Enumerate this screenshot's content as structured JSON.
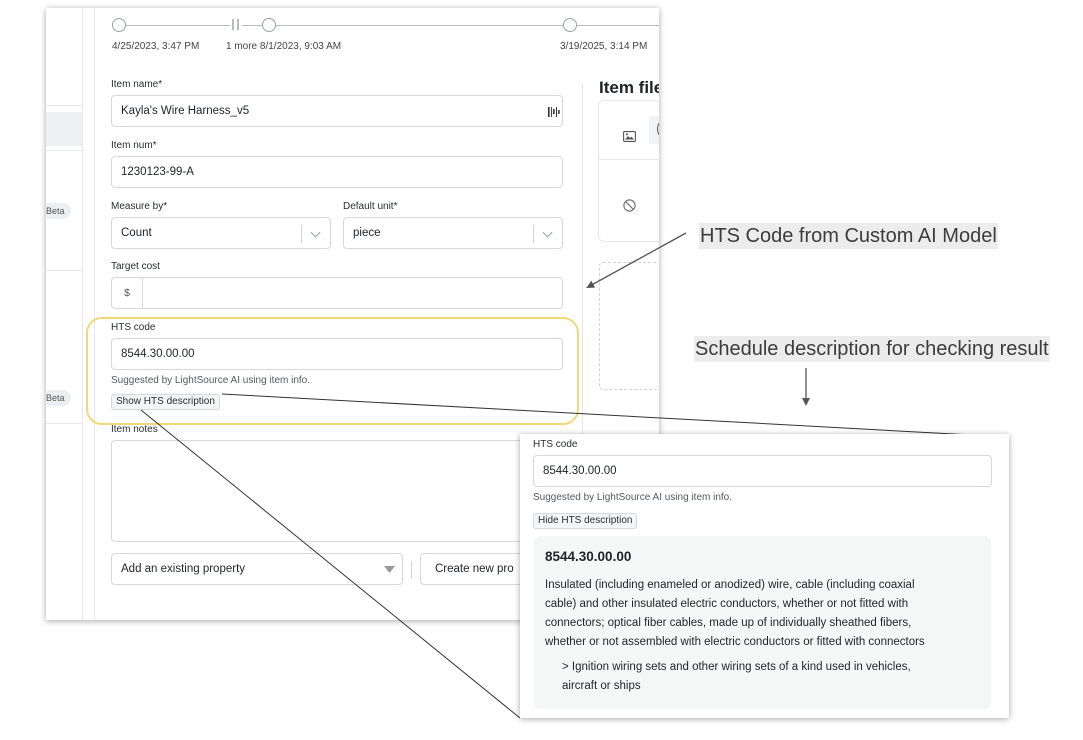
{
  "timeline": {
    "dates": [
      "4/25/2023, 3:47 PM",
      "1 more 8/1/2023, 9:03 AM",
      "3/19/2025, 3:14 PM"
    ]
  },
  "sidebar": {
    "badges": [
      "Beta",
      "Beta"
    ]
  },
  "form": {
    "item_name_label": "Item name*",
    "item_name_value": "Kayla's Wire Harness_v5",
    "item_num_label": "Item num*",
    "item_num_value": "1230123-99-A",
    "measure_label": "Measure by*",
    "measure_value": "Count",
    "unit_label": "Default unit*",
    "unit_value": "piece",
    "target_cost_label": "Target cost",
    "currency_symbol": "$",
    "target_cost_value": "",
    "hts_label": "HTS code",
    "hts_value": "8544.30.00.00",
    "hts_hint": "Suggested by LightSource AI using item info.",
    "show_hts_button": "Show HTS description",
    "notes_label": "Item notes",
    "add_property_label": "Add an existing property",
    "create_property_label": "Create new pro"
  },
  "right_panel": {
    "title": "Item file"
  },
  "annotations": {
    "hts_model": "HTS Code from Custom AI Model",
    "schedule_desc": "Schedule description for checking result"
  },
  "inset": {
    "hts_label": "HTS code",
    "hts_value": "8544.30.00.00",
    "hint": "Suggested by LightSource AI using item info.",
    "hide_button": "Hide HTS description",
    "desc_code": "8544.30.00.00",
    "desc_lines": [
      "Insulated (including enameled or anodized) wire, cable (including coaxial",
      "cable) and other insulated electric conductors, whether or not fitted with",
      "connectors; optical fiber cables, made up of individually sheathed fibers,",
      "whether or not assembled with electric conductors or fitted with connectors"
    ],
    "sub_lines": [
      "> Ignition wiring sets and other wiring sets of a kind used in vehicles,",
      "aircraft or ships"
    ]
  },
  "colors": {
    "highlight": "#f2d77a",
    "desc_background": "#f5f7f6",
    "annotation_background": "#ececec"
  },
  "icons": [
    "image-icon",
    "blocked-icon",
    "chevron-down-icon",
    "barcode-icon",
    "arrow-icon"
  ]
}
